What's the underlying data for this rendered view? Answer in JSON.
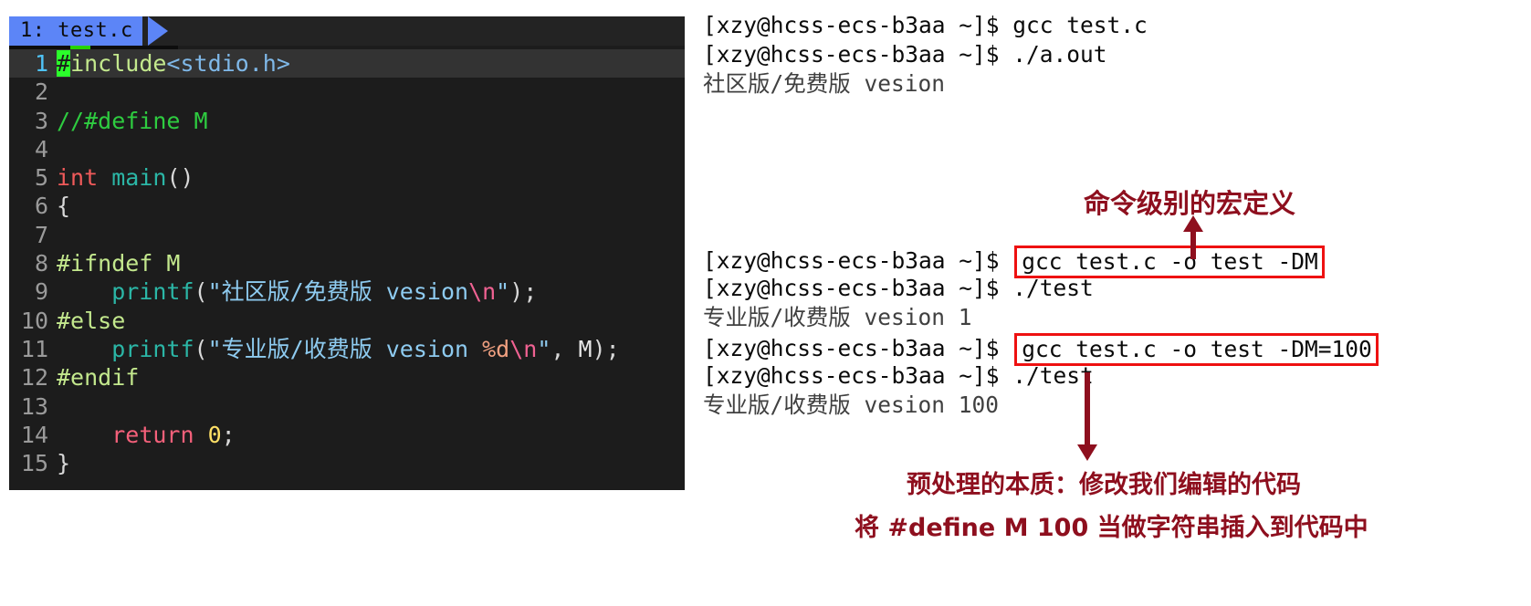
{
  "editor": {
    "tab": {
      "label": "1: test.c"
    },
    "lines": [
      {
        "n": "1",
        "current": true,
        "tokens": [
          {
            "t": "#",
            "c": "t-pre cursor"
          },
          {
            "t": "include",
            "c": "t-pre"
          },
          {
            "t": "<stdio.h>",
            "c": "t-hdr"
          }
        ]
      },
      {
        "n": "2",
        "current": false,
        "tokens": []
      },
      {
        "n": "3",
        "current": false,
        "tokens": [
          {
            "t": "//#define M",
            "c": "t-comment"
          }
        ]
      },
      {
        "n": "4",
        "current": false,
        "tokens": []
      },
      {
        "n": "5",
        "current": false,
        "tokens": [
          {
            "t": "int ",
            "c": "t-type"
          },
          {
            "t": "main",
            "c": "t-fn"
          },
          {
            "t": "()",
            "c": "t-punct"
          }
        ]
      },
      {
        "n": "6",
        "current": false,
        "tokens": [
          {
            "t": "{",
            "c": "t-punct"
          }
        ]
      },
      {
        "n": "7",
        "current": false,
        "tokens": []
      },
      {
        "n": "8",
        "current": false,
        "tokens": [
          {
            "t": "#ifndef M",
            "c": "t-pre"
          }
        ]
      },
      {
        "n": "9",
        "current": false,
        "tokens": [
          {
            "t": "    ",
            "c": "t-punct"
          },
          {
            "t": "printf",
            "c": "t-fn"
          },
          {
            "t": "(",
            "c": "t-punct"
          },
          {
            "t": "\"社区版/免费版 vesion",
            "c": "t-str"
          },
          {
            "t": "\\n",
            "c": "t-esc"
          },
          {
            "t": "\"",
            "c": "t-str"
          },
          {
            "t": ");",
            "c": "t-punct"
          }
        ]
      },
      {
        "n": "10",
        "current": false,
        "tokens": [
          {
            "t": "#else",
            "c": "t-pre"
          }
        ]
      },
      {
        "n": "11",
        "current": false,
        "tokens": [
          {
            "t": "    ",
            "c": "t-punct"
          },
          {
            "t": "printf",
            "c": "t-fn"
          },
          {
            "t": "(",
            "c": "t-punct"
          },
          {
            "t": "\"专业版/收费版 vesion ",
            "c": "t-str"
          },
          {
            "t": "%d",
            "c": "t-fmt"
          },
          {
            "t": "\\n",
            "c": "t-esc"
          },
          {
            "t": "\"",
            "c": "t-str"
          },
          {
            "t": ", ",
            "c": "t-punct"
          },
          {
            "t": "M",
            "c": "t-id"
          },
          {
            "t": ");",
            "c": "t-punct"
          }
        ]
      },
      {
        "n": "12",
        "current": false,
        "tokens": [
          {
            "t": "#endif",
            "c": "t-pre"
          }
        ]
      },
      {
        "n": "13",
        "current": false,
        "tokens": []
      },
      {
        "n": "14",
        "current": false,
        "tokens": [
          {
            "t": "    ",
            "c": "t-punct"
          },
          {
            "t": "return ",
            "c": "t-kw"
          },
          {
            "t": "0",
            "c": "t-num"
          },
          {
            "t": ";",
            "c": "t-punct"
          }
        ]
      },
      {
        "n": "15",
        "current": false,
        "tokens": [
          {
            "t": "}",
            "c": "t-punct"
          }
        ]
      }
    ]
  },
  "terminal": {
    "prompt": "[xzy@hcss-ecs-b3aa ~]$ ",
    "lines": [
      {
        "type": "cmd",
        "prompt": "[xzy@hcss-ecs-b3aa ~]$ ",
        "text": "gcc test.c",
        "boxed": false
      },
      {
        "type": "cmd",
        "prompt": "[xzy@hcss-ecs-b3aa ~]$ ",
        "text": "./a.out",
        "boxed": false
      },
      {
        "type": "output",
        "text": "社区版/免费版 vesion",
        "cn": true
      },
      {
        "type": "blank"
      },
      {
        "type": "blank"
      },
      {
        "type": "blank"
      },
      {
        "type": "blank"
      },
      {
        "type": "blank"
      },
      {
        "type": "cmd",
        "prompt": "[xzy@hcss-ecs-b3aa ~]$ ",
        "text": "gcc test.c -o test -DM",
        "boxed": true
      },
      {
        "type": "cmd",
        "prompt": "[xzy@hcss-ecs-b3aa ~]$ ",
        "text": "./test",
        "boxed": false
      },
      {
        "type": "output",
        "text": "专业版/收费版 vesion 1",
        "cn": true
      },
      {
        "type": "cmd",
        "prompt": "[xzy@hcss-ecs-b3aa ~]$ ",
        "text": "gcc test.c -o test -DM=100",
        "boxed": true
      },
      {
        "type": "cmd",
        "prompt": "[xzy@hcss-ecs-b3aa ~]$ ",
        "text": "./test",
        "boxed": false
      },
      {
        "type": "output",
        "text": "专业版/收费版 vesion 100",
        "cn": true
      }
    ]
  },
  "annotations": {
    "macro_level": "命令级别的宏定义",
    "essence": "预处理的本质：修改我们编辑的代码",
    "insert": "将 #define M 100 当做字符串插入到代码中"
  },
  "colors": {
    "editor_bg": "#1c1c1c",
    "tab_bg": "#5c85f7",
    "current_line_bg": "#333333",
    "cursor_green": "#2bff2b",
    "annotation_red": "#8e0f1e",
    "box_red": "#ee1111",
    "terminal_bg": "#ffffff",
    "terminal_fg": "#0a0a0a"
  }
}
